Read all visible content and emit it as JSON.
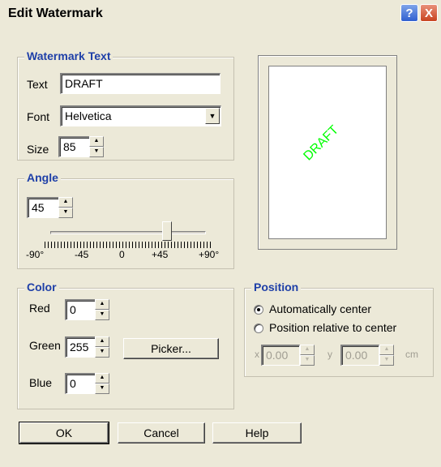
{
  "window": {
    "title": "Edit Watermark",
    "help_glyph": "?",
    "close_glyph": "X"
  },
  "watermark_text": {
    "legend": "Watermark Text",
    "text_label": "Text",
    "text_value": "DRAFT",
    "font_label": "Font",
    "font_value": "Helvetica",
    "size_label": "Size",
    "size_value": "85"
  },
  "angle": {
    "legend": "Angle",
    "value": "45",
    "slider_min": -90,
    "slider_max": 90,
    "slider_value": 45,
    "tick_labels": [
      "-90°",
      "-45",
      "0",
      "+45",
      "+90°"
    ]
  },
  "color": {
    "legend": "Color",
    "red_label": "Red",
    "red_value": "0",
    "green_label": "Green",
    "green_value": "255",
    "blue_label": "Blue",
    "blue_value": "0",
    "picker_label": "Picker...",
    "watermark_color": "#00ff00"
  },
  "position": {
    "legend": "Position",
    "option_auto": "Automatically center",
    "option_relative": "Position relative to center",
    "selected": "auto",
    "x_label": "x",
    "x_value": "0.00",
    "y_label": "y",
    "y_value": "0.00",
    "unit": "cm"
  },
  "preview": {
    "text": "DRAFT"
  },
  "buttons": {
    "ok": "OK",
    "cancel": "Cancel",
    "help": "Help"
  }
}
